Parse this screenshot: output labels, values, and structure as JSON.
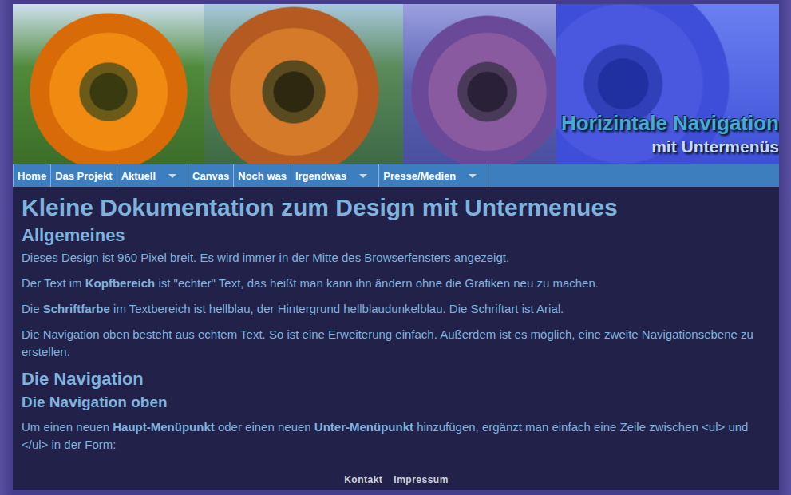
{
  "header": {
    "title": "Horizintale Navigation",
    "subtitle": "mit Untermenüs"
  },
  "nav": [
    {
      "label": "Home",
      "submenu": false
    },
    {
      "label": "Das Projekt",
      "submenu": false
    },
    {
      "label": "Aktuell",
      "submenu": true
    },
    {
      "label": "Canvas",
      "submenu": false
    },
    {
      "label": "Noch was",
      "submenu": false
    },
    {
      "label": "Irgendwas",
      "submenu": true
    },
    {
      "label": "Presse/Medien",
      "submenu": true
    }
  ],
  "content": {
    "blocks": [
      {
        "kind": "h1",
        "text": "Kleine Dokumentation zum Design mit Untermenues"
      },
      {
        "kind": "h2",
        "text": "Allgemeines"
      },
      {
        "kind": "p",
        "segments": [
          {
            "text": "Dieses Design ist 960 Pixel breit. Es wird immer in der Mitte des Browserfensters angezeigt.",
            "bold": false
          }
        ]
      },
      {
        "kind": "p",
        "segments": [
          {
            "text": "Der Text im ",
            "bold": false
          },
          {
            "text": "Kopfbereich",
            "bold": true
          },
          {
            "text": " ist \"echter\" Text, das heißt man kann ihn ändern ohne die Grafiken neu zu machen.",
            "bold": false
          }
        ]
      },
      {
        "kind": "p",
        "segments": [
          {
            "text": "Die ",
            "bold": false
          },
          {
            "text": "Schriftfarbe",
            "bold": true
          },
          {
            "text": " im Textbereich ist hellblau, der Hintergrund hellblaudunkelblau. Die Schriftart ist Arial.",
            "bold": false
          }
        ]
      },
      {
        "kind": "p",
        "segments": [
          {
            "text": "Die Navigation oben besteht aus echtem Text. So ist eine Erweiterung einfach. Außerdem ist es möglich, eine zweite Navigationsebene zu erstellen.",
            "bold": false
          }
        ]
      },
      {
        "kind": "h2",
        "text": "Die Navigation"
      },
      {
        "kind": "h3",
        "text": "Die Navigation oben"
      },
      {
        "kind": "p",
        "segments": [
          {
            "text": "Um einen neuen ",
            "bold": false
          },
          {
            "text": "Haupt-Menüpunkt",
            "bold": true
          },
          {
            "text": " oder einen neuen ",
            "bold": false
          },
          {
            "text": "Unter-Menüpunkt",
            "bold": true
          },
          {
            "text": " hinzufügen, ergänzt man einfach eine Zeile zwischen <ul> und </ul> in der Form:",
            "bold": false
          }
        ]
      }
    ]
  },
  "footer": {
    "links": [
      "Kontakt",
      "Impressum"
    ]
  }
}
